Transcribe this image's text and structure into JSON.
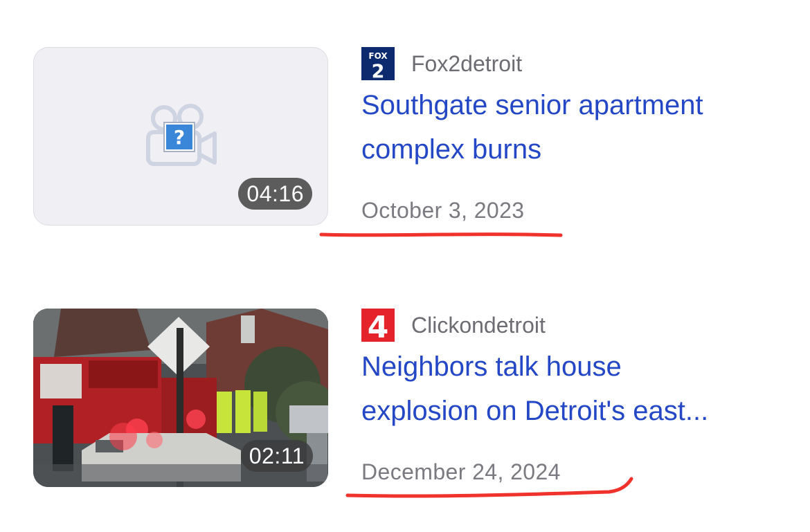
{
  "articles": [
    {
      "source": "Fox2detroit",
      "source_logo_icon": "fox2-logo-icon",
      "source_logo_text_top": "FOX",
      "source_logo_text_bottom": "2",
      "title_line1": "Southgate senior apartment",
      "title_line2": "complex burns",
      "date": "October 3, 2023",
      "duration": "04:16",
      "thumbnail": "broken-video-placeholder-icon"
    },
    {
      "source": "Clickondetroit",
      "source_logo_icon": "channel-4-logo-icon",
      "source_logo_text": "4",
      "title_line1": "Neighbors talk house",
      "title_line2": "explosion on Detroit's east...",
      "date": "December 24, 2024",
      "duration": "02:11",
      "thumbnail": "fire-truck-scene-photo"
    }
  ],
  "colors": {
    "headline": "#2447c6",
    "meta_text": "#6c6c72",
    "annotation_underline": "#f0322c",
    "placeholder_bg": "#efeff4"
  }
}
